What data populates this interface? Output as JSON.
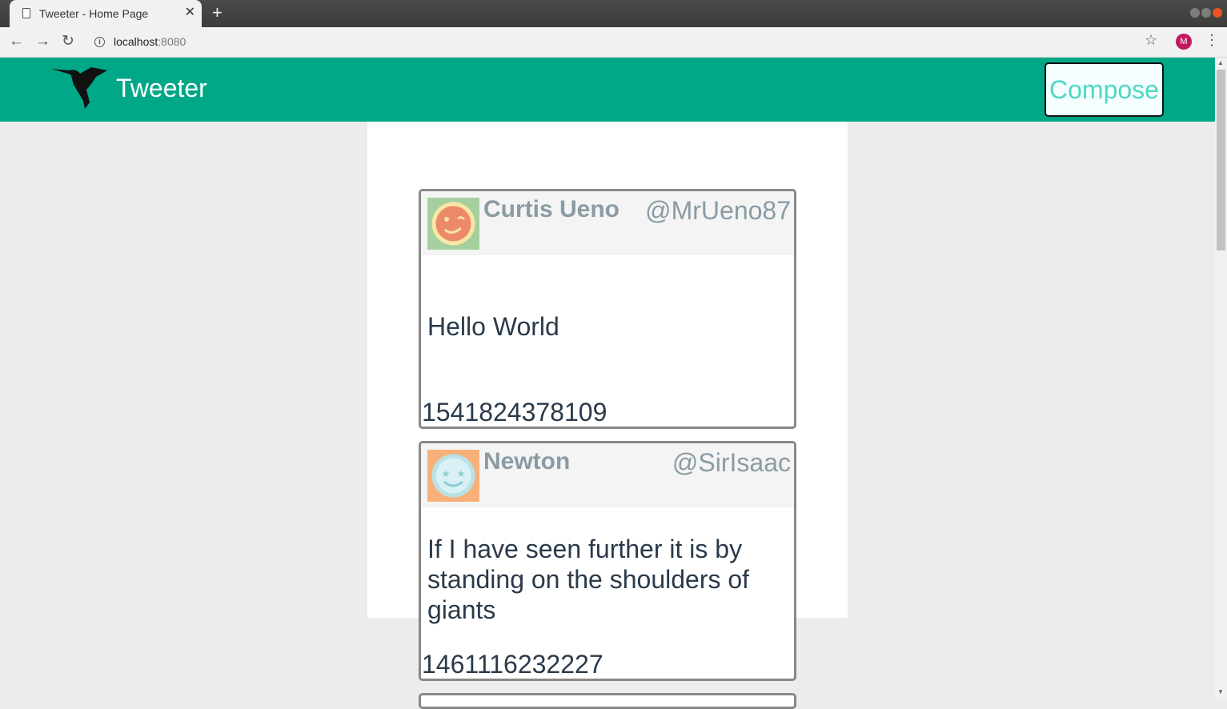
{
  "browser": {
    "tab_title": "Tweeter - Home Page",
    "url_host": "localhost",
    "url_port": ":8080",
    "profile_initial": "M"
  },
  "app": {
    "brand": "Tweeter",
    "compose_label": "Compose",
    "header_color": "#00a887"
  },
  "tweets": [
    {
      "name": "Curtis Ueno",
      "handle": "@MrUeno87",
      "text": "Hello World",
      "timestamp": "1541824378109",
      "avatar": "winking-face-avatar",
      "avatar_bg": "#a6cfa0"
    },
    {
      "name": "Newton",
      "handle": "@SirIsaac",
      "text": "If I have seen further it is by standing on the shoulders of giants",
      "timestamp": "1461116232227",
      "avatar": "star-eyes-face-avatar",
      "avatar_bg": "#f8b07a"
    }
  ]
}
